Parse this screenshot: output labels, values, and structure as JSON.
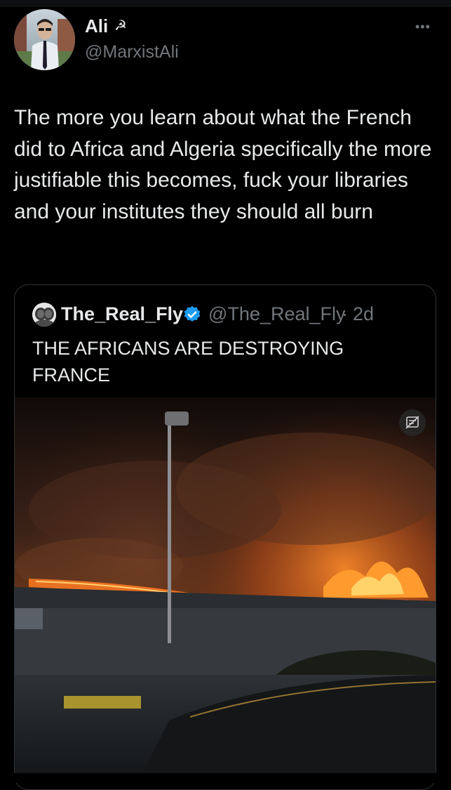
{
  "tweet": {
    "author": {
      "display_name": "Ali",
      "name_emoji": "☭",
      "handle": "@MarxistAli"
    },
    "more_icon": "more-horizontal-icon",
    "more_glyph": "•••",
    "text": "The more you learn about what the French did to Africa and Algeria specifically the more justifiable this becomes, fuck your libraries and your institutes they should all burn"
  },
  "quote": {
    "author": {
      "display_name": "The_Real_Fly",
      "verified_icon": "verified-badge-icon",
      "handle": "@The_Real_Fly",
      "separator": "·",
      "time": "2d"
    },
    "text": "THE AFRICANS ARE DESTROYING FRANCE",
    "media": {
      "description_icon": "content-warning-icon"
    }
  },
  "colors": {
    "background": "#000000",
    "text_primary": "#e7e9ea",
    "text_secondary": "#71767b",
    "border": "#2f3336",
    "verified_blue": "#1d9bf0"
  }
}
